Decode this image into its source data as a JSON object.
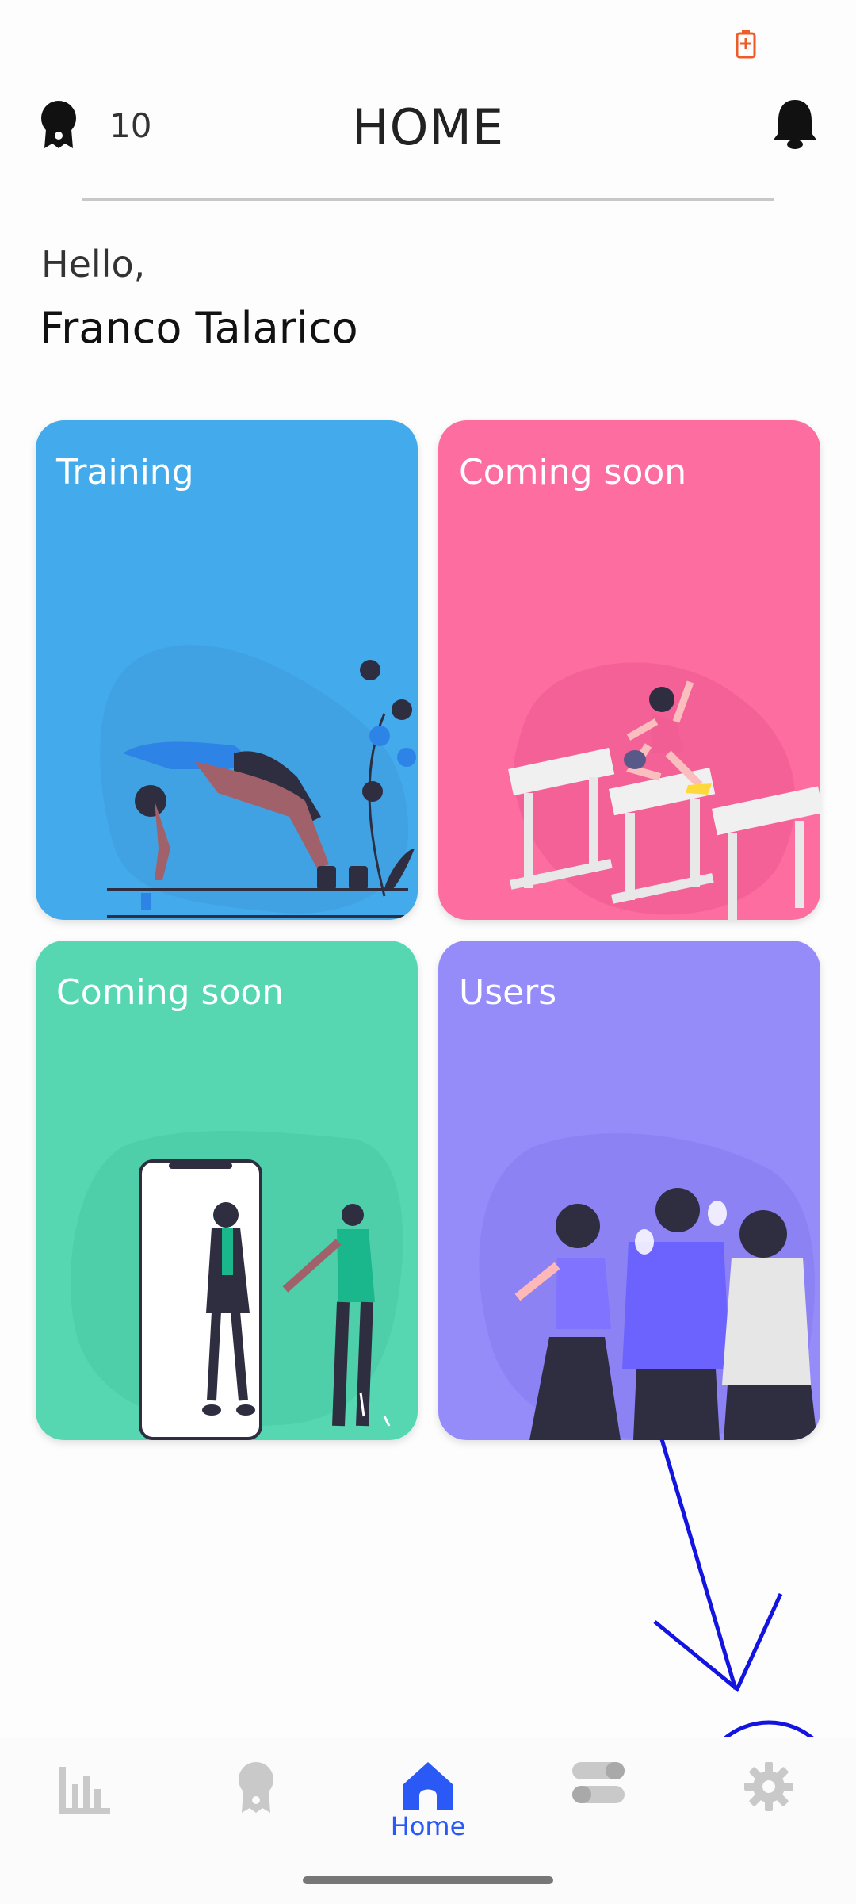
{
  "header": {
    "points": "10",
    "title": "HOME"
  },
  "greeting": {
    "hello": "Hello,",
    "name": "Franco Talarico"
  },
  "cards": [
    {
      "label": "Training",
      "color": "#43aaeb"
    },
    {
      "label": "Coming soon",
      "color": "#fe6d9f"
    },
    {
      "label": "Coming soon",
      "color": "#56d7b2"
    },
    {
      "label": "Users",
      "color": "#958cfa"
    }
  ],
  "nav": {
    "items": [
      {
        "icon": "stats-icon"
      },
      {
        "icon": "medal-icon"
      },
      {
        "icon": "home-icon",
        "label": "Home"
      },
      {
        "icon": "toggles-icon"
      },
      {
        "icon": "gear-icon"
      }
    ],
    "active_color": "#2b59f6"
  }
}
